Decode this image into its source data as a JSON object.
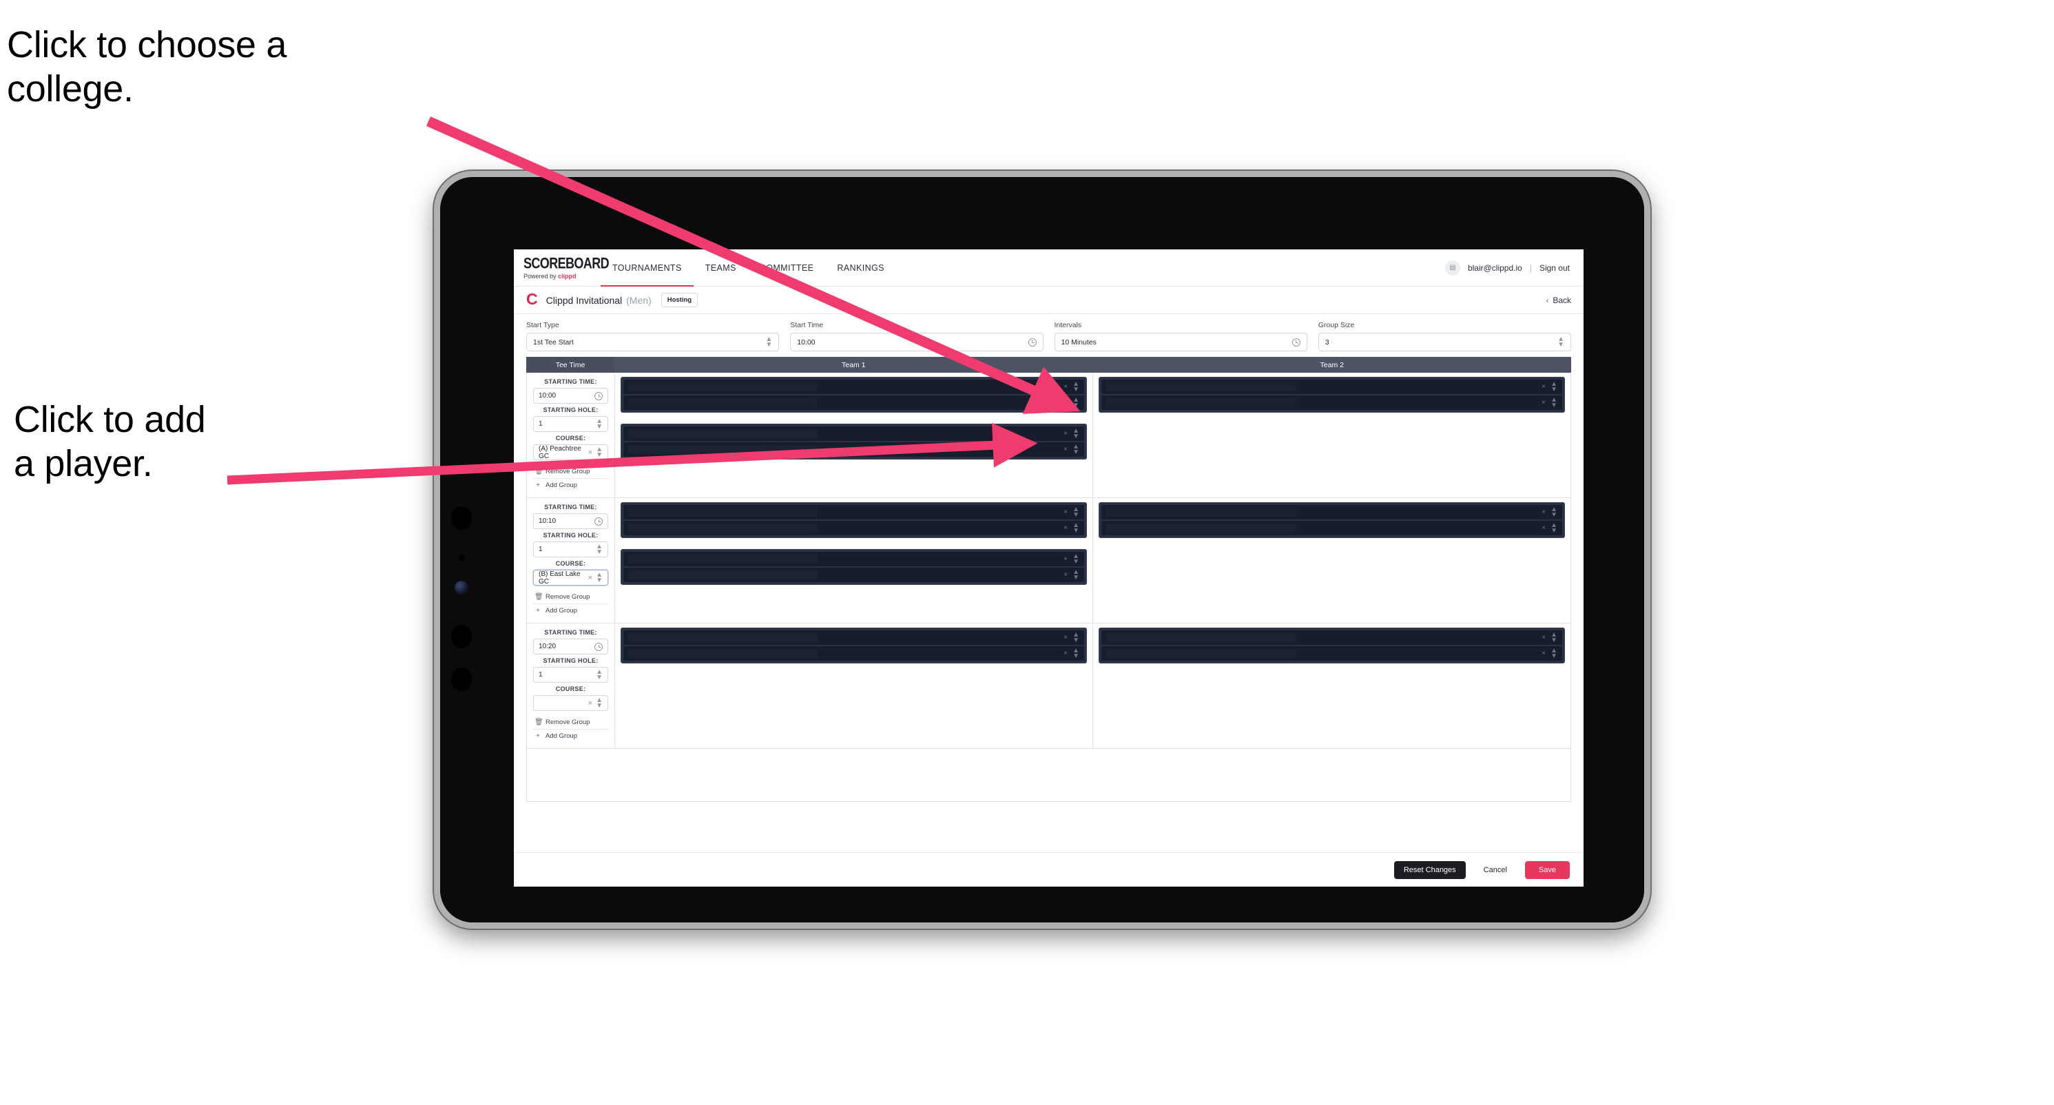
{
  "annotations": {
    "college": "Click to choose a\ncollege.",
    "player": "Click to add\na player."
  },
  "colors": {
    "accent_pink": "#e8375d",
    "nav_active_underline": "#d8324f",
    "table_header_bg": "#4d5466",
    "player_block_bg": "#2b3243",
    "player_row_bg": "#161d2c",
    "dark_button": "#1b1d23"
  },
  "app": {
    "brand": {
      "word": "SCOREBOARD",
      "powered_prefix": "Powered by",
      "powered_brand": "clippd"
    },
    "nav": [
      {
        "label": "TOURNAMENTS",
        "active": true
      },
      {
        "label": "TEAMS",
        "active": false
      },
      {
        "label": "COMMITTEE",
        "active": false
      },
      {
        "label": "RANKINGS",
        "active": false
      }
    ],
    "account": {
      "avatar_icon": "user-avatar-icon",
      "email": "blair@clippd.io",
      "separator": "|",
      "sign_out": "Sign out"
    },
    "tournament": {
      "logo_letter": "C",
      "name": "Clippd Invitational",
      "gender": "(Men)",
      "status_chip": "Hosting",
      "back_label": "Back",
      "back_chevron": "‹"
    },
    "filters": [
      {
        "label": "Start Type",
        "value": "1st Tee Start",
        "icon": "chevron-updown-icon"
      },
      {
        "label": "Start Time",
        "value": "10:00",
        "icon": "clock-icon"
      },
      {
        "label": "Intervals",
        "value": "10 Minutes",
        "icon": "clock-icon"
      },
      {
        "label": "Group Size",
        "value": "3",
        "icon": "chevron-updown-icon"
      }
    ],
    "table": {
      "headers": {
        "tee_time": "Tee Time",
        "team1": "Team 1",
        "team2": "Team 2"
      },
      "field_labels": {
        "starting_time": "STARTING TIME:",
        "starting_hole": "STARTING HOLE:",
        "course": "COURSE:"
      },
      "group_actions": {
        "remove": "Remove Group",
        "add": "Add Group",
        "remove_icon": "trash-icon",
        "add_icon": "plus-icon"
      },
      "rows": [
        {
          "starting_time": "10:00",
          "starting_hole": "1",
          "course": "(A) Peachtree GC",
          "course_focused": false,
          "team1_blocks": [
            2,
            2
          ],
          "team2_blocks": [
            2
          ]
        },
        {
          "starting_time": "10:10",
          "starting_hole": "1",
          "course": "(B) East Lake GC",
          "course_focused": true,
          "team1_blocks": [
            2,
            2
          ],
          "team2_blocks": [
            2
          ]
        },
        {
          "starting_time": "10:20",
          "starting_hole": "1",
          "course": "",
          "course_focused": false,
          "team1_blocks": [
            2
          ],
          "team2_blocks": [
            2
          ]
        }
      ],
      "row_icons": {
        "clear": "×",
        "stepper": "chevron-updown-icon"
      }
    },
    "footer": {
      "reset": "Reset Changes",
      "cancel": "Cancel",
      "save": "Save"
    }
  }
}
